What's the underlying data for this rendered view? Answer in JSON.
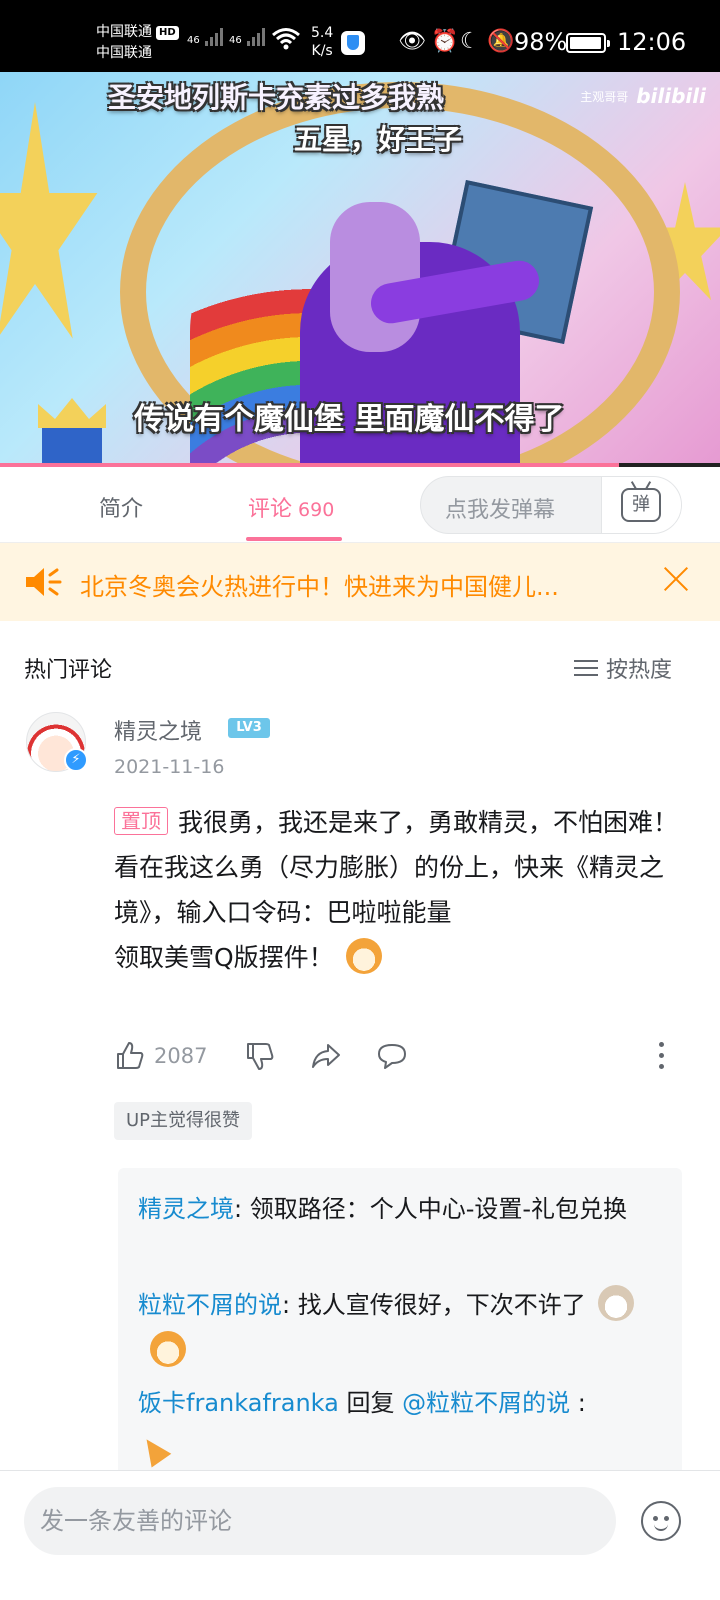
{
  "status_bar": {
    "carrier1": "中国联通",
    "hd_badge": "HD",
    "carrier2": "中国联通",
    "signal1_label": "46",
    "signal2_label": "46",
    "net_speed_value": "5.4",
    "net_speed_unit": "K/s",
    "battery_percent": "98%",
    "battery_level": 0.98,
    "time": "12:06"
  },
  "video": {
    "subtitle_top_1": "圣安地列斯卡充素过多我熟",
    "subtitle_top_2": "五星，好王子",
    "subtitle_bottom": "传说有个魔仙堡 里面魔仙不得了",
    "watermark_author": "主观哥哥",
    "watermark_logo": "bilibili",
    "progress": 0.86,
    "colors": {
      "progress": "#fb7299"
    }
  },
  "tabs": {
    "intro_label": "简介",
    "comments_label": "评论",
    "comments_count": "690",
    "danmaku_placeholder": "点我发弹幕",
    "danmaku_button": "弹"
  },
  "notice": {
    "text": "北京冬奥会火热进行中！快进来为中国健儿..."
  },
  "comments": {
    "section_title": "热门评论",
    "sort_label": "按热度",
    "top_comment": {
      "username": "精灵之境",
      "level_badge": "LV3",
      "date": "2021-11-16",
      "pin_tag": "置顶",
      "text_main": "我很勇，我还是来了，勇敢精灵，不怕困难！看在我这么勇（尽力膨胀）的份上，快来《精灵之境》，输入口令码：巴啦啦能量",
      "text_line2": "领取美雪Q版摆件！",
      "likes": "2087",
      "up_liked_label": "UP主觉得很赞"
    },
    "replies": [
      {
        "user": "精灵之境",
        "sep": ": ",
        "text": "领取路径：个人中心-设置-礼包兑换"
      },
      {
        "user": "粒粒不屑的说",
        "sep": ": ",
        "text": "找人宣传很好，下次不许了"
      },
      {
        "user": "饭卡frankafranka",
        "reply_word": " 回复 ",
        "target": "@粒粒不屑的说",
        "sep": " :"
      }
    ]
  },
  "bottom_bar": {
    "input_placeholder": "发一条友善的评论"
  },
  "icons": {
    "speaker": "speaker-icon",
    "close": "close-icon",
    "like": "thumb-up-icon",
    "dislike": "thumb-down-icon",
    "share": "share-icon",
    "reply": "comment-icon",
    "more": "more-vertical-icon",
    "emoji": "emoji-icon"
  }
}
